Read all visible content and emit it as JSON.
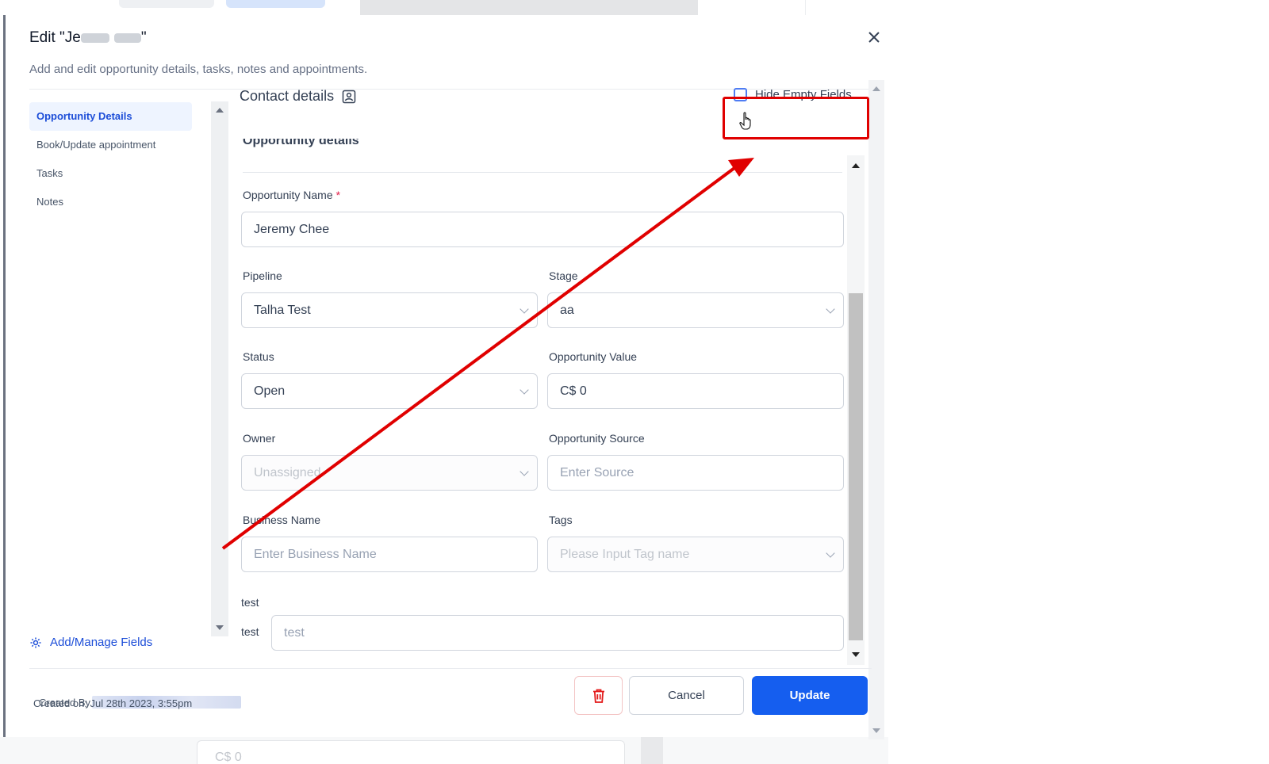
{
  "modal": {
    "title_prefix": "Edit \"Je",
    "title_suffix": "\"",
    "subtitle": "Add and edit opportunity details, tasks, notes and appointments.",
    "close_icon": "close-icon"
  },
  "sidebar": {
    "items": [
      {
        "label": "Opportunity Details",
        "active": true
      },
      {
        "label": "Book/Update appointment",
        "active": false
      },
      {
        "label": "Tasks",
        "active": false
      },
      {
        "label": "Notes",
        "active": false
      }
    ],
    "manage_fields_label": "Add/Manage Fields"
  },
  "section": {
    "title": "Contact details",
    "contact_icon": "contact-card-icon",
    "cut_heading": "Opportunity details"
  },
  "hide_empty": {
    "label": "Hide Empty Fields",
    "checked": false
  },
  "form": {
    "opportunity_name": {
      "label": "Opportunity Name",
      "required_mark": "*",
      "value": "Jeremy Chee"
    },
    "pipeline": {
      "label": "Pipeline",
      "value": "Talha Test"
    },
    "stage": {
      "label": "Stage",
      "value": "aa"
    },
    "status": {
      "label": "Status",
      "value": "Open"
    },
    "opportunity_value": {
      "label": "Opportunity Value",
      "value": "C$ 0"
    },
    "owner": {
      "label": "Owner",
      "placeholder": "Unassigned"
    },
    "opportunity_source": {
      "label": "Opportunity Source",
      "placeholder": "Enter Source"
    },
    "business_name": {
      "label": "Business Name",
      "placeholder": "Enter Business Name"
    },
    "tags": {
      "label": "Tags",
      "placeholder": "Please Input Tag name"
    },
    "custom_group_label": "test",
    "custom_field": {
      "label": "test",
      "placeholder": "test"
    }
  },
  "footer": {
    "created_by_label": "Created By",
    "created_on": "Created on: Jul 28th 2023, 3:55pm",
    "cancel_label": "Cancel",
    "update_label": "Update"
  },
  "background": {
    "card_value": "C$ 0"
  },
  "colors": {
    "primary": "#155eef",
    "annotation_red": "#e00000",
    "active_nav_bg": "#eef4ff"
  }
}
